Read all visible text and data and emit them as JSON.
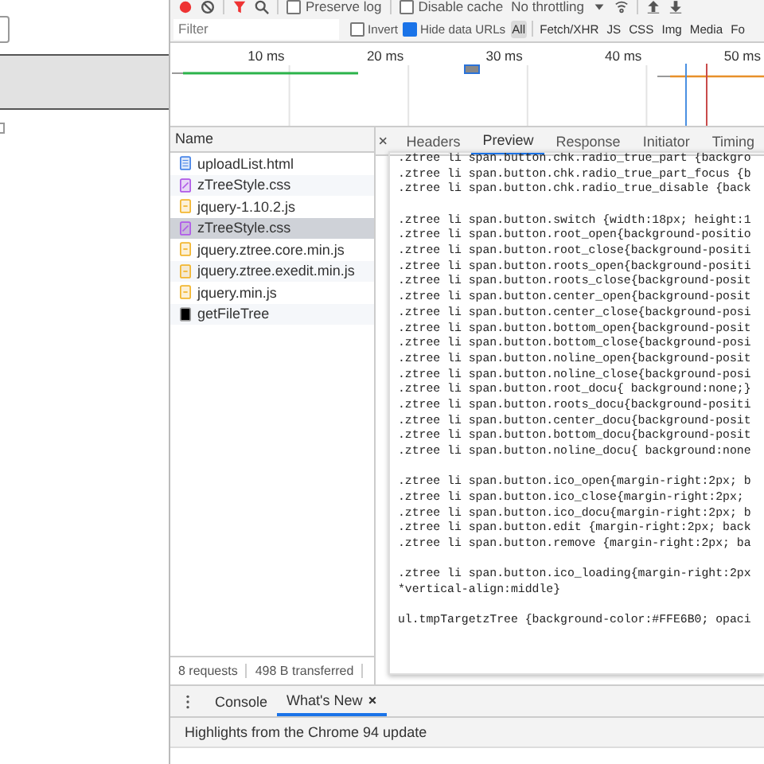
{
  "toolbar": {
    "preserve_log": {
      "label": "Preserve log",
      "checked": false
    },
    "disable_cache": {
      "label": "Disable cache",
      "checked": false
    },
    "throttling": "No throttling"
  },
  "filter_bar": {
    "placeholder": "Filter",
    "invert": {
      "label": "Invert",
      "checked": false
    },
    "hide_data_urls": {
      "label": "Hide data URLs",
      "checked": true
    },
    "types": [
      {
        "label": "All",
        "selected": true
      },
      {
        "label": "Fetch/XHR",
        "selected": false
      },
      {
        "label": "JS",
        "selected": false
      },
      {
        "label": "CSS",
        "selected": false
      },
      {
        "label": "Img",
        "selected": false
      },
      {
        "label": "Media",
        "selected": false
      },
      {
        "label": "Fo",
        "selected": false
      }
    ]
  },
  "timeline": {
    "ticks": [
      "10 ms",
      "20 ms",
      "30 ms",
      "40 ms",
      "50 ms"
    ]
  },
  "requests": {
    "column": "Name",
    "items": [
      {
        "name": "uploadList.html",
        "kind": "html",
        "selected": false
      },
      {
        "name": "zTreeStyle.css",
        "kind": "css",
        "selected": false
      },
      {
        "name": "jquery-1.10.2.js",
        "kind": "js",
        "selected": false
      },
      {
        "name": "zTreeStyle.css",
        "kind": "css",
        "selected": true
      },
      {
        "name": "jquery.ztree.core.min.js",
        "kind": "js",
        "selected": false
      },
      {
        "name": "jquery.ztree.exedit.min.js",
        "kind": "js",
        "selected": false
      },
      {
        "name": "jquery.min.js",
        "kind": "js",
        "selected": false
      },
      {
        "name": "getFileTree",
        "kind": "xhr",
        "selected": false
      }
    ],
    "summary": [
      "8 requests",
      "498 B transferred"
    ]
  },
  "detail_tabs": [
    {
      "label": "Headers",
      "selected": false
    },
    {
      "label": "Preview",
      "selected": true
    },
    {
      "label": "Response",
      "selected": false
    },
    {
      "label": "Initiator",
      "selected": false
    },
    {
      "label": "Timing",
      "selected": false
    }
  ],
  "preview_blocks": [
    [
      ".ztree li span.button.chk.radio_true_part {backgro",
      ".ztree li span.button.chk.radio_true_part_focus {b",
      ".ztree li span.button.chk.radio_true_disable {back"
    ],
    [
      ".ztree li span.button.switch {width:18px; height:1",
      ".ztree li span.button.root_open{background-positio",
      ".ztree li span.button.root_close{background-positi",
      ".ztree li span.button.roots_open{background-positi",
      ".ztree li span.button.roots_close{background-posit",
      ".ztree li span.button.center_open{background-posit",
      ".ztree li span.button.center_close{background-posi",
      ".ztree li span.button.bottom_open{background-posit",
      ".ztree li span.button.bottom_close{background-posi",
      ".ztree li span.button.noline_open{background-posit",
      ".ztree li span.button.noline_close{background-posi",
      ".ztree li span.button.root_docu{ background:none;}",
      ".ztree li span.button.roots_docu{background-positi",
      ".ztree li span.button.center_docu{background-posit",
      ".ztree li span.button.bottom_docu{background-posit",
      ".ztree li span.button.noline_docu{ background:none"
    ],
    [
      ".ztree li span.button.ico_open{margin-right:2px; b",
      ".ztree li span.button.ico_close{margin-right:2px;",
      ".ztree li span.button.ico_docu{margin-right:2px; b",
      ".ztree li span.button.edit {margin-right:2px; back",
      ".ztree li span.button.remove {margin-right:2px; ba"
    ],
    [
      ".ztree li span.button.ico_loading{margin-right:2px",
      "*vertical-align:middle}"
    ],
    [
      "ul.tmpTargetzTree {background-color:#FFE6B0; opaci"
    ]
  ],
  "drawer": {
    "tabs": [
      {
        "label": "Console",
        "selected": false,
        "closable": false
      },
      {
        "label": "What's New",
        "selected": true,
        "closable": true
      }
    ],
    "headline": "Highlights from the Chrome 94 update"
  }
}
